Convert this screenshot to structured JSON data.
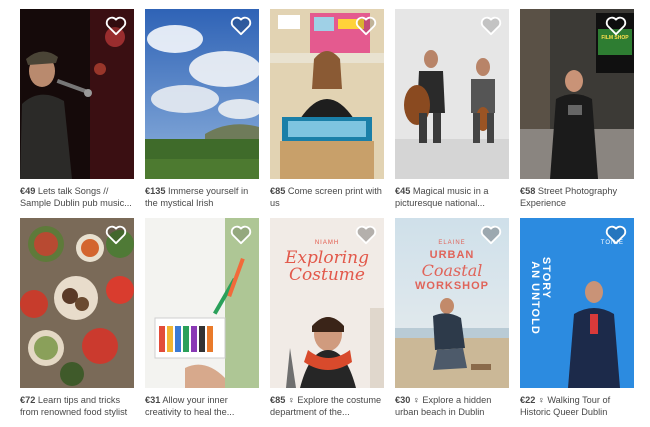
{
  "experiences": [
    {
      "price": "€49",
      "title": "Lets talk Songs // Sample Dublin pub music...",
      "icon": "heart-icon",
      "saved": false
    },
    {
      "price": "€135",
      "title": "Immerse yourself in the mystical Irish Dreamtime",
      "icon": "heart-icon",
      "saved": false
    },
    {
      "price": "€85",
      "title": "Come screen print with us",
      "icon": "heart-icon",
      "saved": false
    },
    {
      "price": "€45",
      "title": "Magical music in a picturesque national...",
      "icon": "heart-icon",
      "saved": false
    },
    {
      "price": "€58",
      "title": "Street Photography Experience",
      "icon": "heart-icon",
      "saved": false,
      "poster_text": "FILM SHOP"
    },
    {
      "price": "€72",
      "title": "Learn tips and tricks from renowned food stylist",
      "icon": "heart-icon",
      "saved": false
    },
    {
      "price": "€31",
      "title": "Allow your inner creativity to heal the...",
      "icon": "heart-icon",
      "saved": false
    },
    {
      "price": "€85",
      "title": "♀ Explore the costume department of the...",
      "icon": "heart-icon",
      "saved": false,
      "poster_host": "NIAMH",
      "poster_title": "Exploring Costume"
    },
    {
      "price": "€30",
      "title": "♀ Explore a hidden urban beach in Dublin",
      "icon": "heart-icon",
      "saved": false,
      "poster_host": "ELAINE",
      "poster_title_1": "URBAN",
      "poster_title_2": "Coastal",
      "poster_title_3": "WORKSHOP"
    },
    {
      "price": "€22",
      "title": "♀ Walking Tour of Historic Queer Dublin",
      "icon": "heart-icon",
      "saved": false,
      "poster_host": "TONIE",
      "poster_title_1": "AN UNTOLD",
      "poster_title_2": "STORY"
    }
  ],
  "colors": {
    "text": "#484848",
    "heart_stroke": "#ffffff",
    "costume_bg": "#f1ebe6",
    "costume_text": "#e2584a",
    "coastal_text": "#e0645a",
    "untold_bg": "#2c8be0"
  }
}
